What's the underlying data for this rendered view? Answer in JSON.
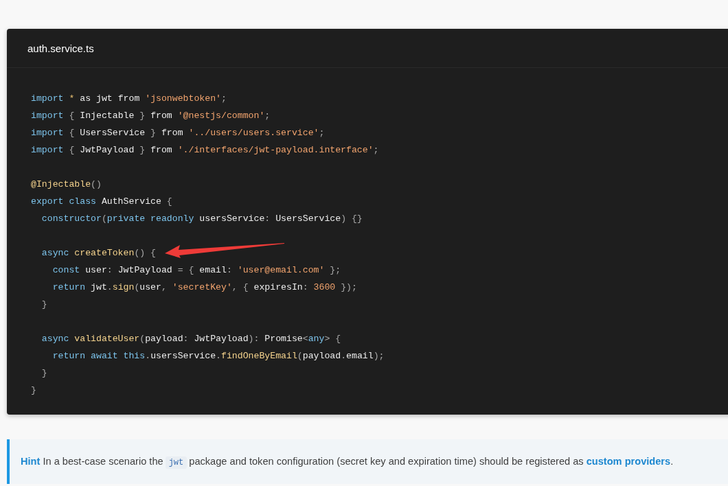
{
  "code_block": {
    "filename": "auth.service.ts",
    "lines": [
      {
        "kind": "code",
        "tokens": [
          {
            "kind": "keyword",
            "text": "import "
          },
          {
            "kind": "operator",
            "text": "*"
          },
          {
            "kind": "plain",
            "text": " as jwt from "
          },
          {
            "kind": "string",
            "text": "'jsonwebtoken'"
          },
          {
            "kind": "punct",
            "text": ";"
          }
        ]
      },
      {
        "kind": "code",
        "tokens": [
          {
            "kind": "keyword",
            "text": "import"
          },
          {
            "kind": "punct",
            "text": " { "
          },
          {
            "kind": "plain",
            "text": "Injectable"
          },
          {
            "kind": "punct",
            "text": " } "
          },
          {
            "kind": "plain",
            "text": "from "
          },
          {
            "kind": "string",
            "text": "'@nestjs/common'"
          },
          {
            "kind": "punct",
            "text": ";"
          }
        ]
      },
      {
        "kind": "code",
        "tokens": [
          {
            "kind": "keyword",
            "text": "import"
          },
          {
            "kind": "punct",
            "text": " { "
          },
          {
            "kind": "plain",
            "text": "UsersService"
          },
          {
            "kind": "punct",
            "text": " } "
          },
          {
            "kind": "plain",
            "text": "from "
          },
          {
            "kind": "string",
            "text": "'../users/users.service'"
          },
          {
            "kind": "punct",
            "text": ";"
          }
        ]
      },
      {
        "kind": "code",
        "tokens": [
          {
            "kind": "keyword",
            "text": "import"
          },
          {
            "kind": "punct",
            "text": " { "
          },
          {
            "kind": "plain",
            "text": "JwtPayload"
          },
          {
            "kind": "punct",
            "text": " } "
          },
          {
            "kind": "plain",
            "text": "from "
          },
          {
            "kind": "string",
            "text": "'./interfaces/jwt-payload.interface'"
          },
          {
            "kind": "punct",
            "text": ";"
          }
        ]
      },
      {
        "kind": "blank"
      },
      {
        "kind": "code",
        "tokens": [
          {
            "kind": "function",
            "text": "@Injectable"
          },
          {
            "kind": "punct",
            "text": "()"
          }
        ]
      },
      {
        "kind": "code",
        "tokens": [
          {
            "kind": "keyword",
            "text": "export class"
          },
          {
            "kind": "plain",
            "text": " AuthService "
          },
          {
            "kind": "punct",
            "text": "{"
          }
        ]
      },
      {
        "kind": "code",
        "tokens": [
          {
            "kind": "keyword",
            "text": "  constructor"
          },
          {
            "kind": "punct",
            "text": "("
          },
          {
            "kind": "keyword",
            "text": "private readonly"
          },
          {
            "kind": "plain",
            "text": " usersService"
          },
          {
            "kind": "punct",
            "text": ": "
          },
          {
            "kind": "plain",
            "text": "UsersService"
          },
          {
            "kind": "punct",
            "text": ") {}"
          }
        ]
      },
      {
        "kind": "blank"
      },
      {
        "kind": "code",
        "tokens": [
          {
            "kind": "keyword",
            "text": "  async "
          },
          {
            "kind": "function",
            "text": "createToken"
          },
          {
            "kind": "punct",
            "text": "() {"
          }
        ]
      },
      {
        "kind": "code",
        "tokens": [
          {
            "kind": "keyword",
            "text": "    const"
          },
          {
            "kind": "plain",
            "text": " user"
          },
          {
            "kind": "punct",
            "text": ": "
          },
          {
            "kind": "plain",
            "text": "JwtPayload "
          },
          {
            "kind": "punct",
            "text": "= { "
          },
          {
            "kind": "plain",
            "text": "email"
          },
          {
            "kind": "punct",
            "text": ": "
          },
          {
            "kind": "string",
            "text": "'user@email.com'"
          },
          {
            "kind": "punct",
            "text": " };"
          }
        ]
      },
      {
        "kind": "code",
        "tokens": [
          {
            "kind": "keyword",
            "text": "    return"
          },
          {
            "kind": "plain",
            "text": " jwt"
          },
          {
            "kind": "punct",
            "text": "."
          },
          {
            "kind": "function",
            "text": "sign"
          },
          {
            "kind": "punct",
            "text": "("
          },
          {
            "kind": "plain",
            "text": "user"
          },
          {
            "kind": "punct",
            "text": ", "
          },
          {
            "kind": "string",
            "text": "'secretKey'"
          },
          {
            "kind": "punct",
            "text": ", { "
          },
          {
            "kind": "plain",
            "text": "expiresIn"
          },
          {
            "kind": "punct",
            "text": ": "
          },
          {
            "kind": "number",
            "text": "3600"
          },
          {
            "kind": "punct",
            "text": " });"
          }
        ]
      },
      {
        "kind": "code",
        "tokens": [
          {
            "kind": "punct",
            "text": "  }"
          }
        ]
      },
      {
        "kind": "blank"
      },
      {
        "kind": "code",
        "tokens": [
          {
            "kind": "keyword",
            "text": "  async "
          },
          {
            "kind": "function",
            "text": "validateUser"
          },
          {
            "kind": "punct",
            "text": "("
          },
          {
            "kind": "plain",
            "text": "payload"
          },
          {
            "kind": "punct",
            "text": ": "
          },
          {
            "kind": "plain",
            "text": "JwtPayload"
          },
          {
            "kind": "punct",
            "text": "): "
          },
          {
            "kind": "plain",
            "text": "Promise"
          },
          {
            "kind": "punct",
            "text": "<"
          },
          {
            "kind": "keyword",
            "text": "any"
          },
          {
            "kind": "punct",
            "text": "> {"
          }
        ]
      },
      {
        "kind": "code",
        "tokens": [
          {
            "kind": "keyword",
            "text": "    return await this"
          },
          {
            "kind": "punct",
            "text": "."
          },
          {
            "kind": "plain",
            "text": "usersService"
          },
          {
            "kind": "punct",
            "text": "."
          },
          {
            "kind": "function",
            "text": "findOneByEmail"
          },
          {
            "kind": "punct",
            "text": "("
          },
          {
            "kind": "plain",
            "text": "payload"
          },
          {
            "kind": "punct",
            "text": "."
          },
          {
            "kind": "plain",
            "text": "email"
          },
          {
            "kind": "punct",
            "text": ");"
          }
        ]
      },
      {
        "kind": "code",
        "tokens": [
          {
            "kind": "punct",
            "text": "  }"
          }
        ]
      },
      {
        "kind": "code",
        "tokens": [
          {
            "kind": "punct",
            "text": "}"
          }
        ]
      }
    ]
  },
  "hint": {
    "label": "Hint",
    "before": "In a best-case scenario the",
    "code": "jwt",
    "after": "package and token configuration (secret key and expiration time) should be registered as",
    "link": "custom providers",
    "end": "."
  }
}
